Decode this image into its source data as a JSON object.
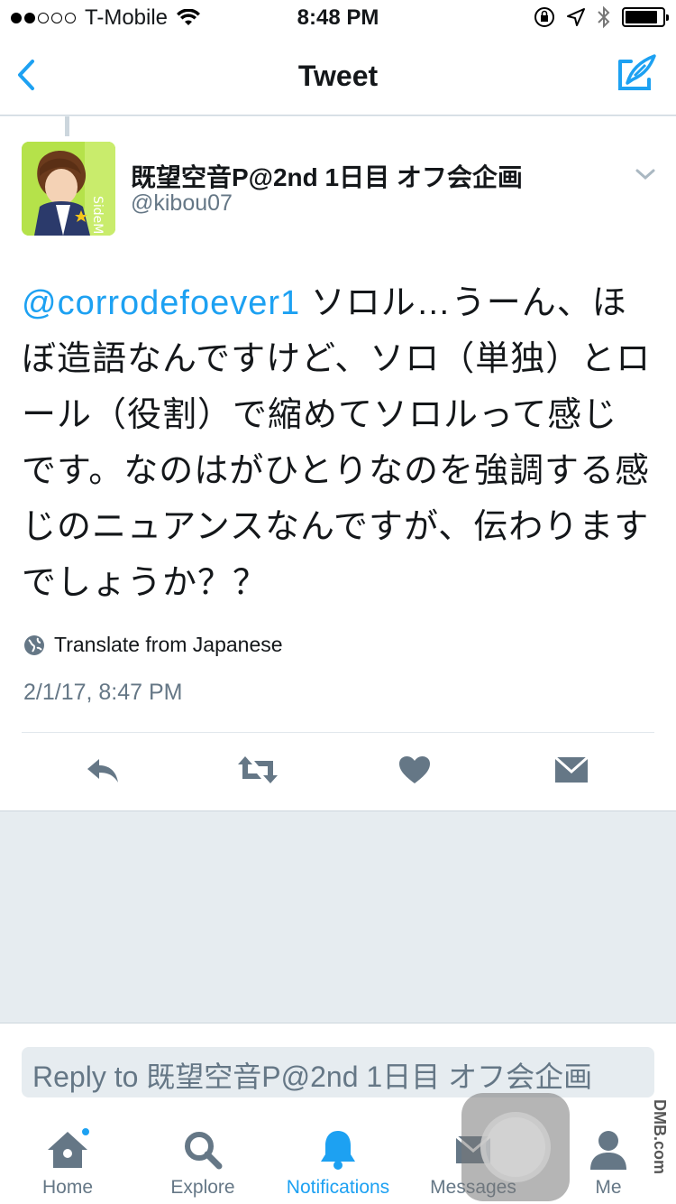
{
  "status_bar": {
    "carrier": "T-Mobile",
    "time": "8:48 PM",
    "signal_bars_filled": 2,
    "signal_bars_total": 5
  },
  "nav": {
    "title": "Tweet"
  },
  "tweet": {
    "author_name": "既望空音P@2nd 1日目 オフ会企画",
    "author_handle": "@kibou07",
    "mention": "@corrodefoever1",
    "body": " ソロル…うーん、ほぼ造語なんですけど、ソロ（単独）とロール（役割）で縮めてソロルって感じです。なのはがひとりなのを強調する感じのニュアンスなんですが、伝わりますでしょうか？？",
    "translate_label": "Translate from Japanese",
    "timestamp": "2/1/17, 8:47 PM"
  },
  "reply": {
    "placeholder": "Reply to 既望空音P@2nd 1日目 オフ会企画"
  },
  "tabs": [
    {
      "label": "Home",
      "icon": "home-icon",
      "active": false
    },
    {
      "label": "Explore",
      "icon": "search-icon",
      "active": false
    },
    {
      "label": "Notifications",
      "icon": "bell-icon",
      "active": true
    },
    {
      "label": "Messages",
      "icon": "envelope-icon",
      "active": false
    },
    {
      "label": "Me",
      "icon": "person-icon",
      "active": false
    }
  ],
  "watermark": "DMB.com",
  "colors": {
    "accent": "#1da1f2",
    "secondary_text": "#657786",
    "icon_gray": "#8899a6",
    "background": "#e6ecf0"
  }
}
